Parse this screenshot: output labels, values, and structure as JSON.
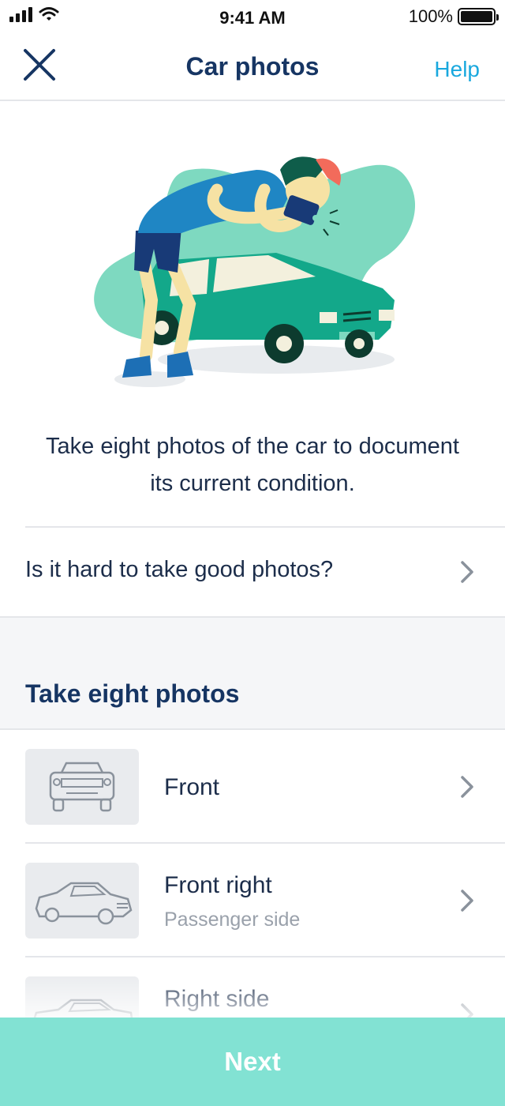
{
  "status_bar": {
    "time": "9:41 AM",
    "battery_percent": "100%",
    "battery_level": 1.0
  },
  "nav": {
    "title": "Car photos",
    "help_label": "Help",
    "close_icon": "close-icon"
  },
  "intro": {
    "text": "Take eight photos of the car to document its current condition."
  },
  "tips": {
    "label": "Is it hard to take good photos?"
  },
  "section": {
    "title": "Take eight photos"
  },
  "photos": [
    {
      "title": "Front",
      "subtitle": "",
      "icon": "car-front-icon"
    },
    {
      "title": "Front right",
      "subtitle": "Passenger side",
      "icon": "car-front-right-icon"
    },
    {
      "title": "Right side",
      "subtitle": "",
      "icon": "car-right-side-icon"
    }
  ],
  "footer": {
    "next_label": "Next"
  },
  "colors": {
    "primary_text": "#163563",
    "help_link": "#19a8de",
    "next_button": "#82e2d3",
    "illustration_green": "#7ed9c0",
    "car_teal": "#13a88a"
  }
}
